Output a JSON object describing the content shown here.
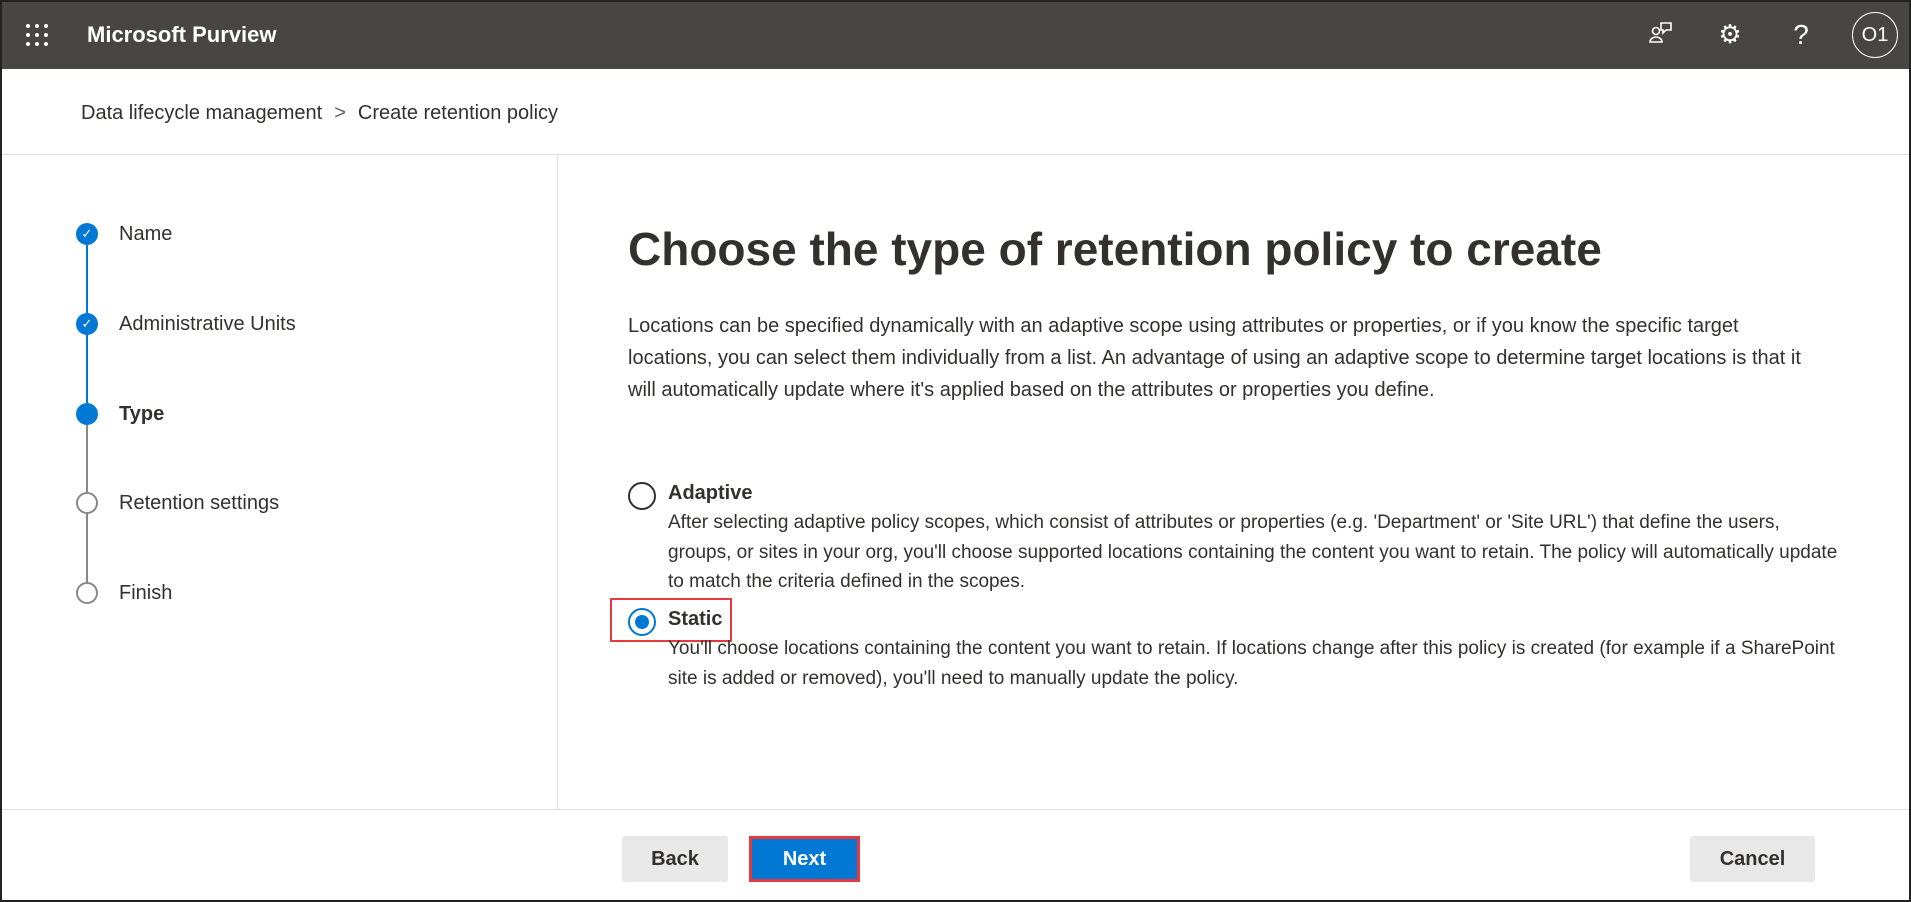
{
  "header": {
    "title": "Microsoft Purview",
    "avatar": "O1",
    "icons": [
      "waffle-icon",
      "feedback-icon",
      "gear-icon",
      "help-icon"
    ],
    "help_glyph": "?",
    "settings_glyph": "⚙"
  },
  "breadcrumb": {
    "items": [
      "Data lifecycle management",
      "Create retention policy"
    ],
    "separator": ">"
  },
  "steps": [
    {
      "label": "Name",
      "state": "done"
    },
    {
      "label": "Administrative Units",
      "state": "done"
    },
    {
      "label": "Type",
      "state": "current"
    },
    {
      "label": "Retention settings",
      "state": "todo"
    },
    {
      "label": "Finish",
      "state": "todo"
    }
  ],
  "main": {
    "title": "Choose the type of retention policy to create",
    "description": "Locations can be specified dynamically with an adaptive scope using attributes or properties, or if you know the specific target locations, you can select them individually from a list. An advantage of using an adaptive scope to determine target locations is that it will automatically update where it's applied based on the attributes or properties you define.",
    "options": [
      {
        "label": "Adaptive",
        "selected": false,
        "description": "After selecting adaptive policy scopes, which consist of attributes or properties (e.g. 'Department' or 'Site URL') that define the users, groups, or sites in your org, you'll choose supported locations containing the content you want to retain. The policy will automatically update to match the criteria defined in the scopes."
      },
      {
        "label": "Static",
        "selected": true,
        "description": "You'll choose locations containing the content you want to retain. If locations change after this policy is created (for example if a SharePoint site is added or removed), you'll need to manually update the policy."
      }
    ]
  },
  "footer": {
    "back": "Back",
    "next": "Next",
    "cancel": "Cancel"
  },
  "colors": {
    "accent": "#0078d4",
    "topbar": "#484644",
    "highlight": "#e8383d"
  }
}
